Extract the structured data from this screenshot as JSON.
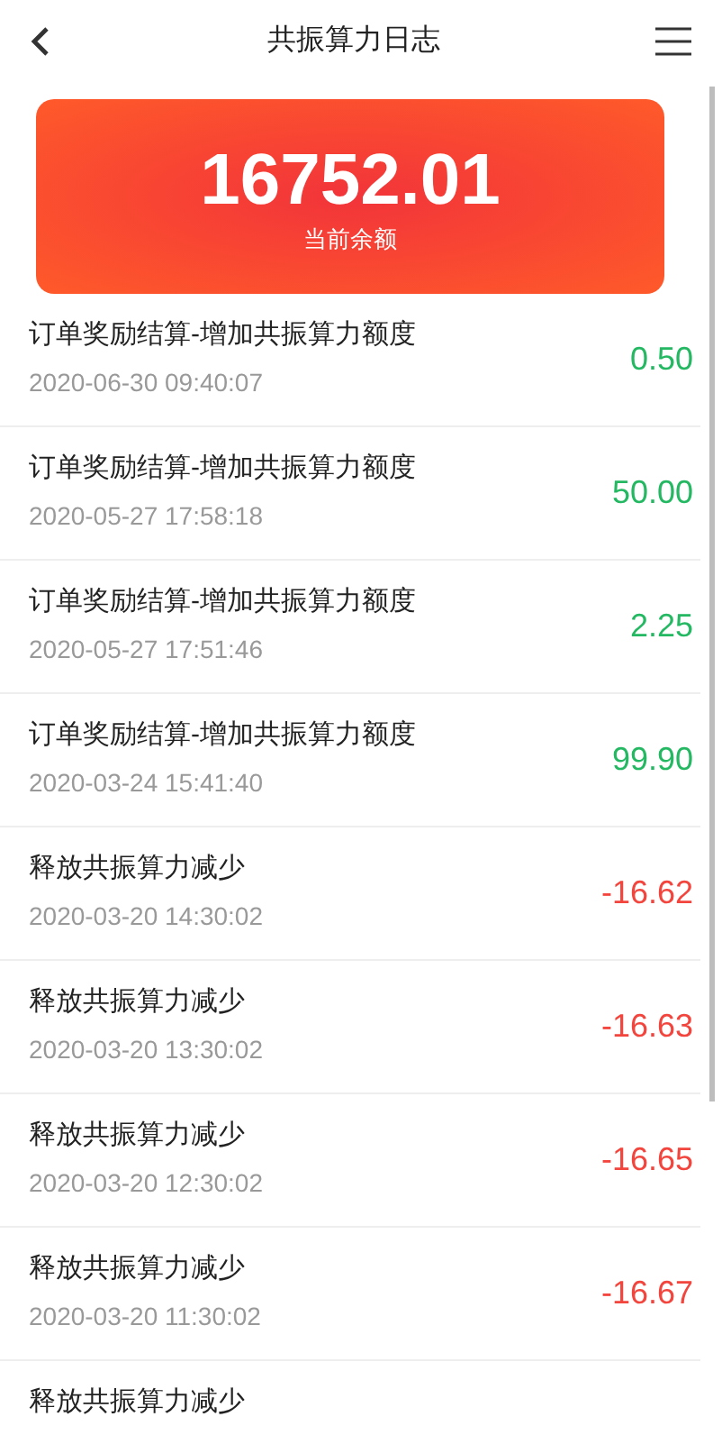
{
  "header": {
    "title": "共振算力日志"
  },
  "balance": {
    "amount": "16752.01",
    "label": "当前余额"
  },
  "records": [
    {
      "title": "订单奖励结算-增加共振算力额度",
      "time": "2020-06-30 09:40:07",
      "amount": "0.50",
      "kind": "income"
    },
    {
      "title": "订单奖励结算-增加共振算力额度",
      "time": "2020-05-27 17:58:18",
      "amount": "50.00",
      "kind": "income"
    },
    {
      "title": "订单奖励结算-增加共振算力额度",
      "time": "2020-05-27 17:51:46",
      "amount": "2.25",
      "kind": "income"
    },
    {
      "title": "订单奖励结算-增加共振算力额度",
      "time": "2020-03-24 15:41:40",
      "amount": "99.90",
      "kind": "income"
    },
    {
      "title": "释放共振算力减少",
      "time": "2020-03-20 14:30:02",
      "amount": "-16.62",
      "kind": "expense"
    },
    {
      "title": "释放共振算力减少",
      "time": "2020-03-20 13:30:02",
      "amount": "-16.63",
      "kind": "expense"
    },
    {
      "title": "释放共振算力减少",
      "time": "2020-03-20 12:30:02",
      "amount": "-16.65",
      "kind": "expense"
    },
    {
      "title": "释放共振算力减少",
      "time": "2020-03-20 11:30:02",
      "amount": "-16.67",
      "kind": "expense"
    },
    {
      "title": "释放共振算力减少"
    }
  ]
}
